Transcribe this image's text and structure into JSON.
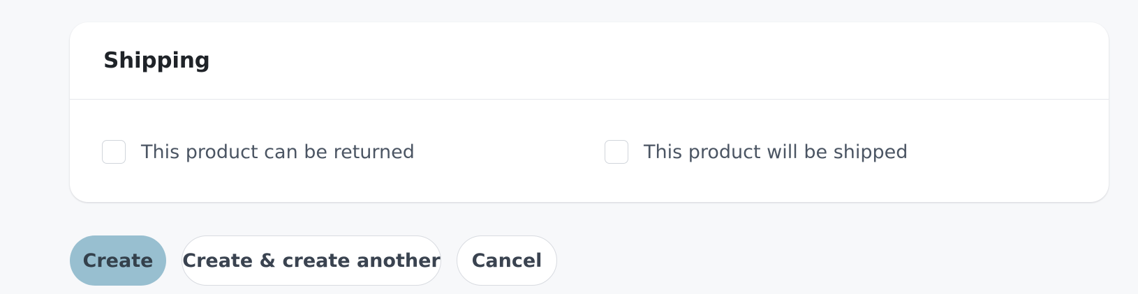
{
  "shipping": {
    "title": "Shipping",
    "options": [
      {
        "label": "This product can be returned",
        "checked": false
      },
      {
        "label": "This product will be shipped",
        "checked": false
      }
    ]
  },
  "actions": {
    "create_label": "Create",
    "create_another_label": "Create & create another",
    "cancel_label": "Cancel"
  },
  "colors": {
    "page_background": "#f7f8fa",
    "primary_button": "#98bfd0",
    "card_background": "#ffffff"
  }
}
